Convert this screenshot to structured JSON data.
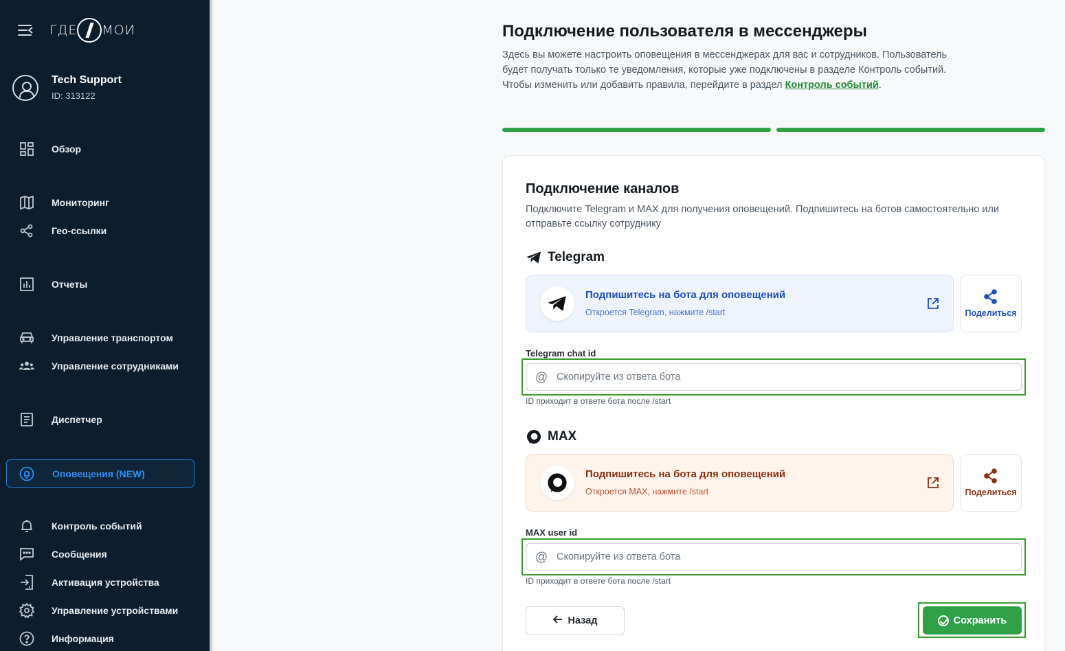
{
  "app": {
    "logo_text_left": "ГДЕ",
    "logo_text_right": "МОИ"
  },
  "user": {
    "name": "Tech Support",
    "id_label": "ID: 313122"
  },
  "sidebar": {
    "items": [
      {
        "label": "Обзор",
        "icon": "dashboard-icon"
      },
      {
        "label": "Мониторинг",
        "icon": "map-icon"
      },
      {
        "label": "Гео-ссылки",
        "icon": "share-icon"
      },
      {
        "label": "Отчеты",
        "icon": "chart-icon"
      },
      {
        "label": "Управление транспортом",
        "icon": "car-icon"
      },
      {
        "label": "Управление сотрудниками",
        "icon": "people-icon"
      },
      {
        "label": "Диспетчер",
        "icon": "document-icon"
      },
      {
        "label": "Оповещения (NEW)",
        "icon": "at-icon",
        "active": true
      },
      {
        "label": "Контроль событий",
        "icon": "bell-icon"
      },
      {
        "label": "Сообщения",
        "icon": "chat-icon"
      },
      {
        "label": "Активация устройства",
        "icon": "login-icon"
      },
      {
        "label": "Управление устройствами",
        "icon": "gear-icon"
      },
      {
        "label": "Информация",
        "icon": "help-icon"
      }
    ]
  },
  "page": {
    "title": "Подключение пользователя в мессенджеры",
    "desc_part1": "Здесь вы можете настроить оповещения в мессенджерах для вас и сотрудников. Пользователь будет получать только те уведомления, которые уже подключены в разделе Контроль событий. Чтобы изменить или добавить правила, перейдите в раздел ",
    "desc_link": "Контроль событий",
    "desc_end": ".",
    "progress_steps_completed": 2,
    "progress_steps_total": 2
  },
  "card": {
    "title": "Подключение каналов",
    "desc": "Подключите Telegram и MAX для получения оповещений. Подпишитесь на ботов самостоятельно или отправьте ссылку сотруднику"
  },
  "telegram": {
    "name": "Telegram",
    "subscribe_title": "Подпишитесь на бота для оповещений",
    "subscribe_hint": "Откроется Telegram, нажмите /start",
    "share_label": "Поделиться",
    "field_label": "Telegram chat id",
    "field_value": "",
    "field_placeholder": "Скопируйте из ответа бота",
    "field_hint": "ID приходит в ответе бота после /start"
  },
  "max": {
    "name": "MAX",
    "subscribe_title": "Подпишитесь на бота для оповещений",
    "subscribe_hint": "Откроется MAX, нажмите /start",
    "share_label": "Поделиться",
    "field_label": "MAX user id",
    "field_value": "",
    "field_placeholder": "Скопируйте из ответа бота",
    "field_hint": "ID приходит в ответе бота после /start"
  },
  "actions": {
    "back_label": "Назад",
    "save_label": "Сохранить"
  },
  "colors": {
    "sidebar_bg": "#0c1d2e",
    "accent_green": "#2fa046",
    "active_blue": "#2f8ff0",
    "telegram_blue": "#1e4fb5",
    "max_brown": "#8a2e0e"
  }
}
